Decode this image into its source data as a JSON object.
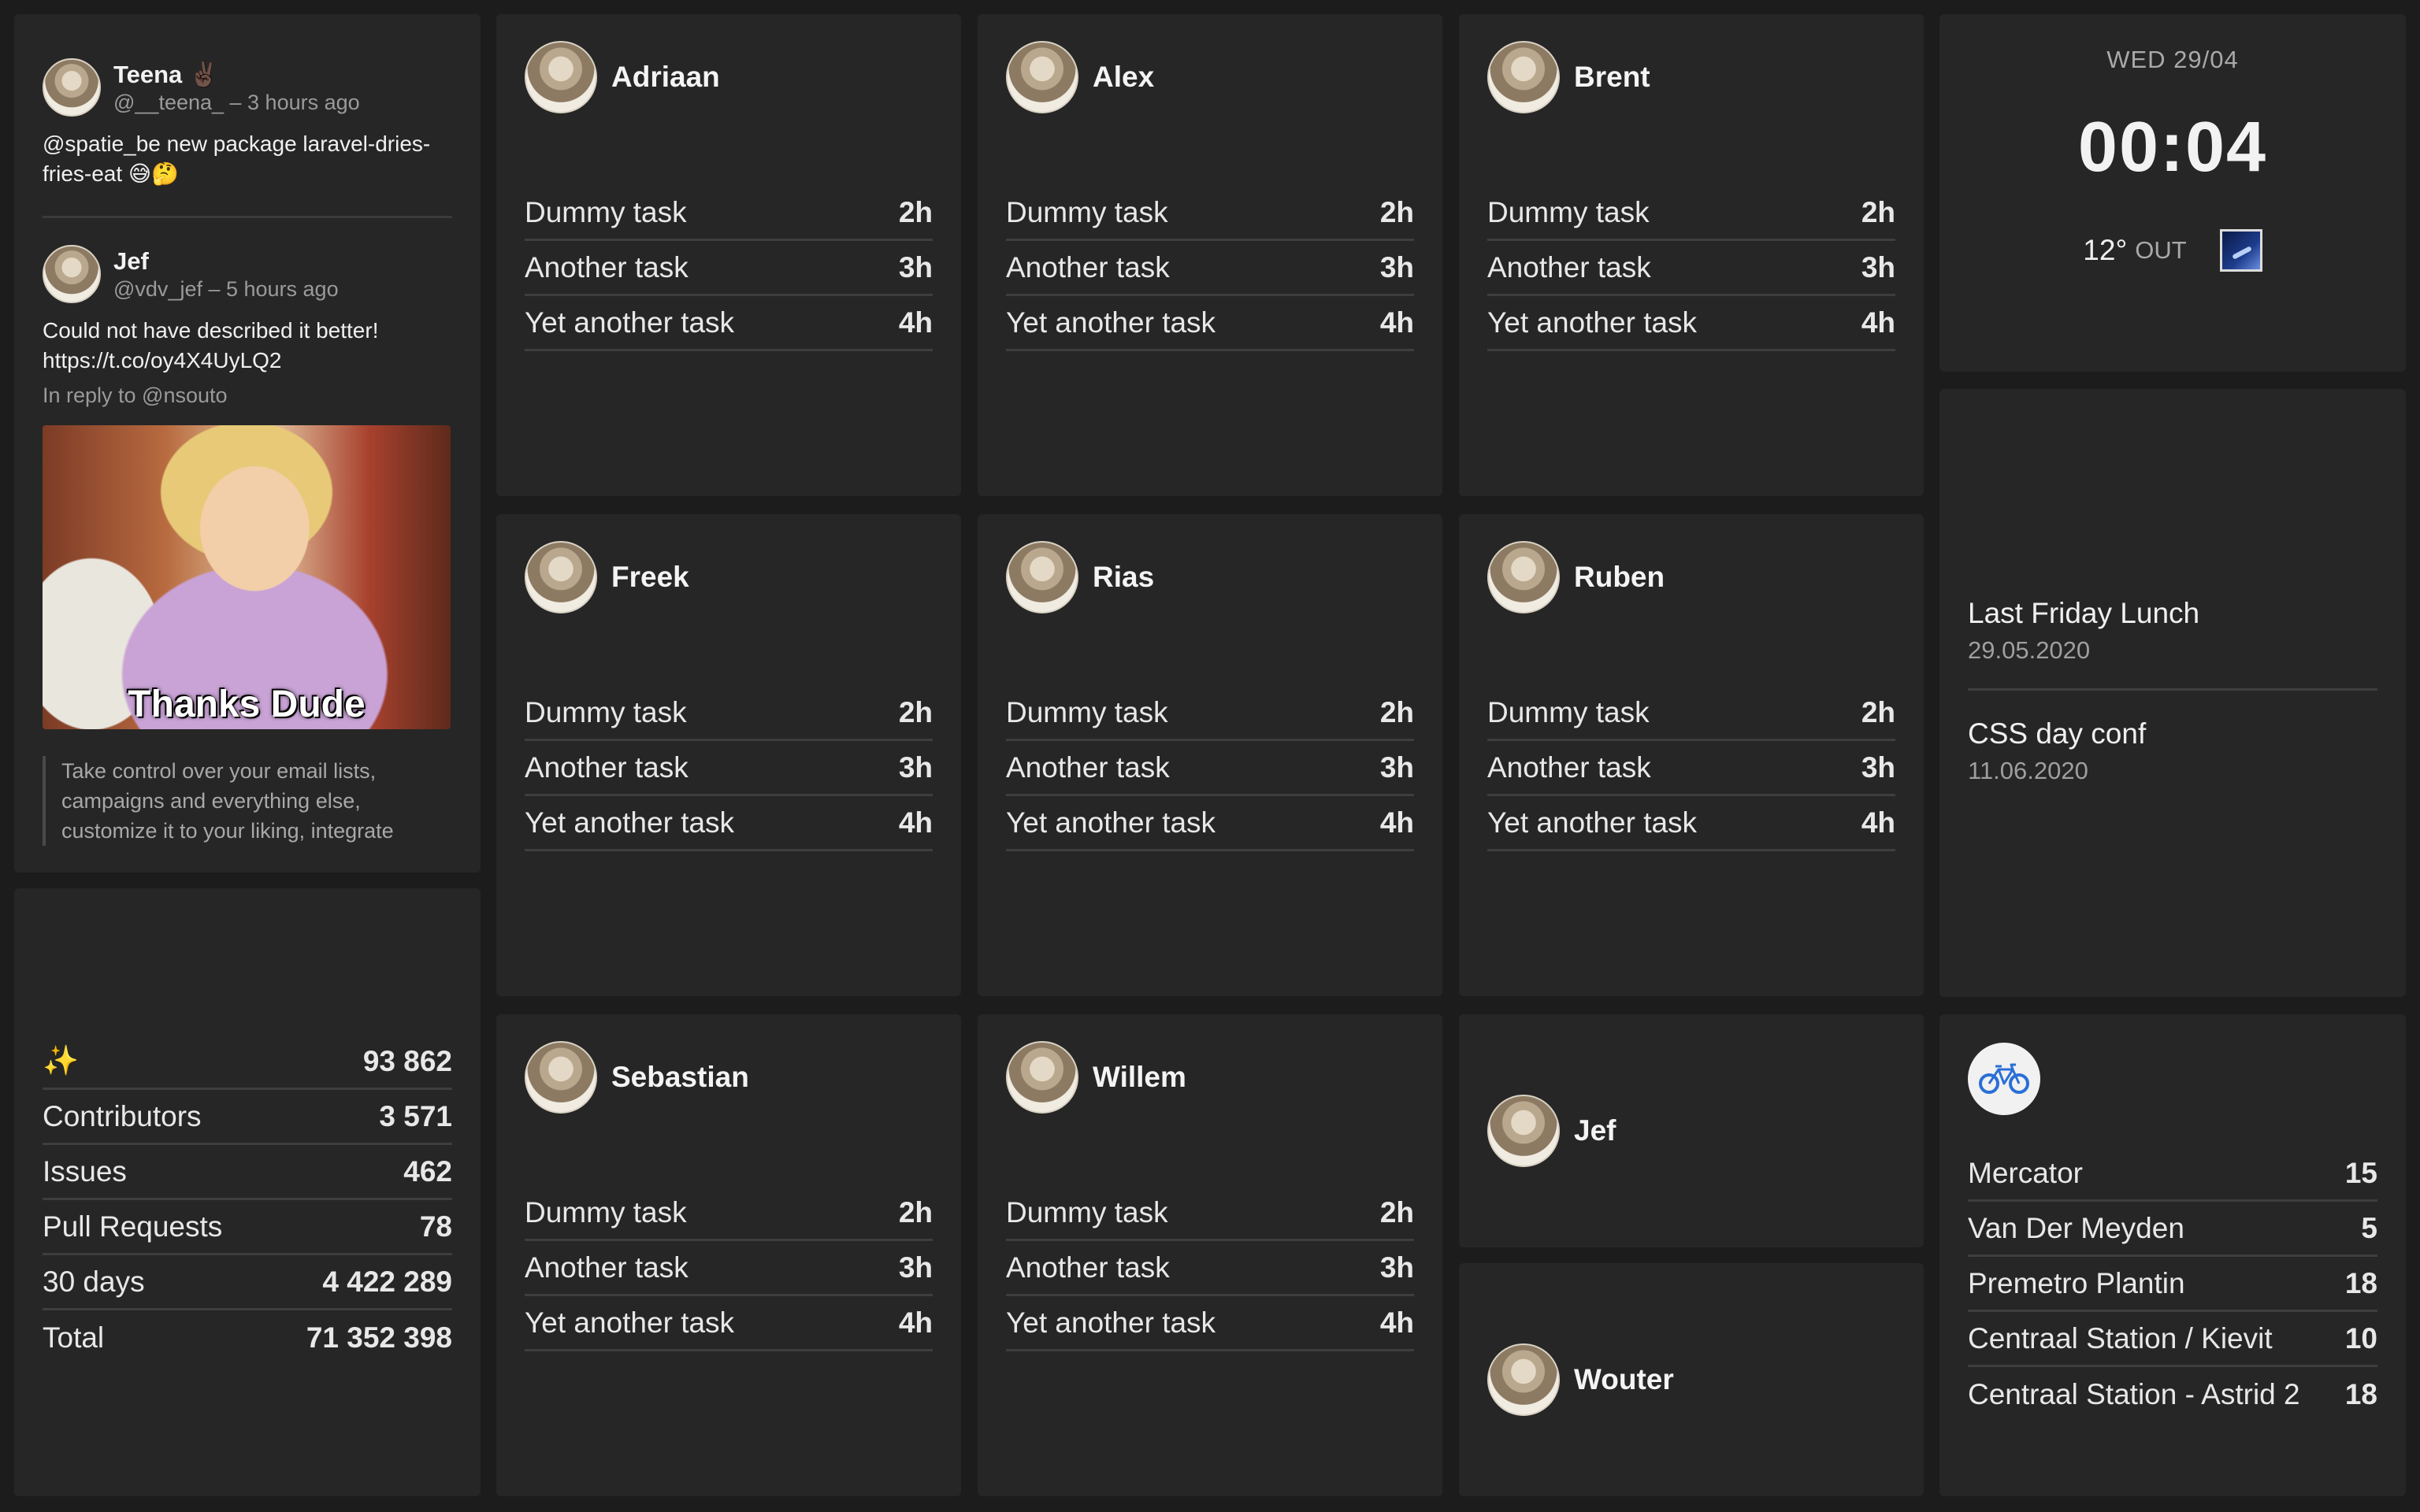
{
  "twitter": {
    "tweets": [
      {
        "name": "Teena ✌🏿",
        "meta": "@__teena_ – 3 hours ago",
        "text": "@spatie_be new package laravel-dries-fries-eat 😅🤔"
      },
      {
        "name": "Jef",
        "meta": "@vdv_jef – 5 hours ago",
        "text": "Could not have described it better! https://t.co/oy4X4UyLQ2",
        "reply": "In reply to @nsouto",
        "gif_caption": "Thanks Dude",
        "quote": "Take control over your email lists, campaigns and everything else, customize it to your liking, integrate"
      }
    ]
  },
  "task_tiles": [
    {
      "name": "Adriaan",
      "tasks": [
        {
          "label": "Dummy task",
          "value": "2h"
        },
        {
          "label": "Another task",
          "value": "3h"
        },
        {
          "label": "Yet another task",
          "value": "4h"
        }
      ]
    },
    {
      "name": "Alex",
      "tasks": [
        {
          "label": "Dummy task",
          "value": "2h"
        },
        {
          "label": "Another task",
          "value": "3h"
        },
        {
          "label": "Yet another task",
          "value": "4h"
        }
      ]
    },
    {
      "name": "Brent",
      "tasks": [
        {
          "label": "Dummy task",
          "value": "2h"
        },
        {
          "label": "Another task",
          "value": "3h"
        },
        {
          "label": "Yet another task",
          "value": "4h"
        }
      ]
    },
    {
      "name": "Freek",
      "tasks": [
        {
          "label": "Dummy task",
          "value": "2h"
        },
        {
          "label": "Another task",
          "value": "3h"
        },
        {
          "label": "Yet another task",
          "value": "4h"
        }
      ]
    },
    {
      "name": "Rias",
      "tasks": [
        {
          "label": "Dummy task",
          "value": "2h"
        },
        {
          "label": "Another task",
          "value": "3h"
        },
        {
          "label": "Yet another task",
          "value": "4h"
        }
      ]
    },
    {
      "name": "Ruben",
      "tasks": [
        {
          "label": "Dummy task",
          "value": "2h"
        },
        {
          "label": "Another task",
          "value": "3h"
        },
        {
          "label": "Yet another task",
          "value": "4h"
        }
      ]
    },
    {
      "name": "Sebastian",
      "tasks": [
        {
          "label": "Dummy task",
          "value": "2h"
        },
        {
          "label": "Another task",
          "value": "3h"
        },
        {
          "label": "Yet another task",
          "value": "4h"
        }
      ]
    },
    {
      "name": "Willem",
      "tasks": [
        {
          "label": "Dummy task",
          "value": "2h"
        },
        {
          "label": "Another task",
          "value": "3h"
        },
        {
          "label": "Yet another task",
          "value": "4h"
        }
      ]
    }
  ],
  "github_stats": {
    "stars_icon": "✨",
    "rows": [
      {
        "label": "✨",
        "value": "93 862"
      },
      {
        "label": "Contributors",
        "value": "3 571"
      },
      {
        "label": "Issues",
        "value": "462"
      },
      {
        "label": "Pull Requests",
        "value": "78"
      },
      {
        "label": "30 days",
        "value": "4 422 289"
      },
      {
        "label": "Total",
        "value": "71 352 398"
      }
    ]
  },
  "clock": {
    "date": "WED 29/04",
    "time": "00:04",
    "temperature": "12°",
    "temperature_label": "OUT",
    "weather_icon": "rain-night-icon"
  },
  "calendar": {
    "events": [
      {
        "title": "Last Friday Lunch",
        "date": "29.05.2020"
      },
      {
        "title": "CSS day conf",
        "date": "11.06.2020"
      }
    ]
  },
  "presence": [
    {
      "name": "Jef"
    },
    {
      "name": "Wouter"
    }
  ],
  "velo": {
    "icon": "bicycle-icon",
    "stations": [
      {
        "label": "Mercator",
        "value": "15"
      },
      {
        "label": "Van Der Meyden",
        "value": "5"
      },
      {
        "label": "Premetro Plantin",
        "value": "18"
      },
      {
        "label": "Centraal Station / Kievit",
        "value": "10"
      },
      {
        "label": "Centraal Station - Astrid 2",
        "value": "18"
      }
    ]
  },
  "colors": {
    "background": "#1c1c1c",
    "tile": "#262626",
    "divider": "#3e3e3e",
    "muted_text": "#9a9a9a"
  }
}
